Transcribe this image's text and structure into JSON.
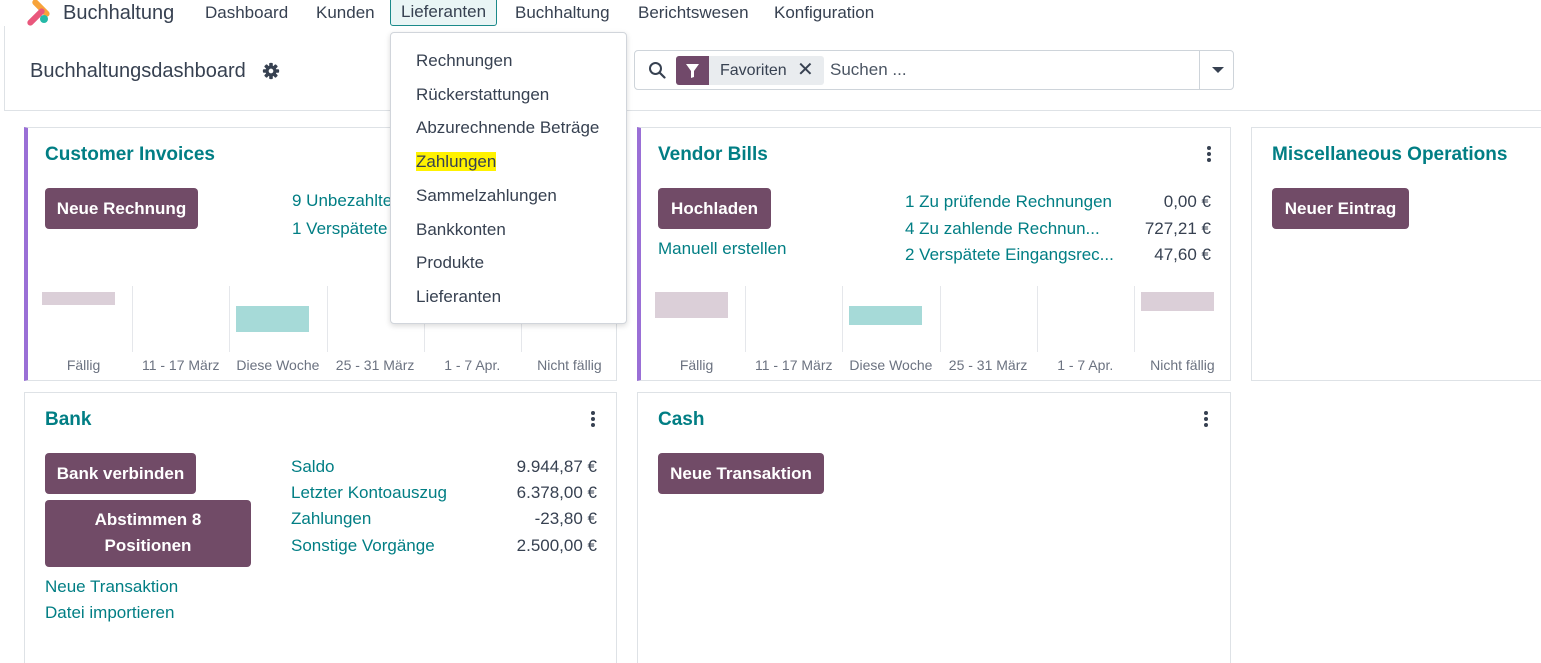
{
  "app": {
    "name": "Buchhaltung",
    "menu": [
      "Dashboard",
      "Kunden",
      "Lieferanten",
      "Buchhaltung",
      "Berichtswesen",
      "Konfiguration"
    ],
    "active_menu": "Lieferanten"
  },
  "control_panel": {
    "breadcrumb": "Buchhaltungsdashboard",
    "search": {
      "facet_label": "Favoriten",
      "placeholder": "Suchen ..."
    }
  },
  "dropdown": {
    "items": [
      "Rechnungen",
      "Rückerstattungen",
      "Abzurechnende Beträge",
      "Zahlungen",
      "Sammelzahlungen",
      "Bankkonten",
      "Produkte",
      "Lieferanten"
    ],
    "highlighted": "Zahlungen"
  },
  "cards": {
    "customer_invoices": {
      "title": "Customer Invoices",
      "button": "Neue Rechnung",
      "links": [
        "9 Unbezahlte",
        "1 Verspätete"
      ]
    },
    "vendor_bills": {
      "title": "Vendor Bills",
      "button": "Hochladen",
      "secondary_link": "Manuell erstellen",
      "rows": [
        {
          "label": "1 Zu prüfende Rechnungen",
          "amount": "0,00 €"
        },
        {
          "label": "4 Zu zahlende Rechnun...",
          "amount": "727,21 €"
        },
        {
          "label": "2 Verspätete Eingangsrec...",
          "amount": "47,60 €"
        }
      ]
    },
    "misc": {
      "title": "Miscellaneous Operations",
      "button": "Neuer Eintrag"
    },
    "bank": {
      "title": "Bank",
      "button_connect": "Bank verbinden",
      "button_reconcile": "Abstimmen 8 Positionen",
      "links": [
        "Neue Transaktion",
        "Datei importieren"
      ],
      "rows": [
        {
          "label": "Saldo",
          "amount": "9.944,87 €"
        },
        {
          "label": "Letzter Kontoauszug",
          "amount": "6.378,00 €"
        },
        {
          "label": "Zahlungen",
          "amount": "-23,80 €"
        },
        {
          "label": "Sonstige Vorgänge",
          "amount": "2.500,00 €"
        }
      ]
    },
    "cash": {
      "title": "Cash",
      "button": "Neue Transaktion"
    }
  },
  "chart_data": [
    {
      "type": "bar",
      "categories": [
        "Fällig",
        "11 - 17 März",
        "Diese Woche",
        "25 - 31 März",
        "1 - 7 Apr.",
        "Nicht fällig"
      ],
      "values": [
        15,
        0,
        30,
        0,
        0,
        0
      ],
      "current_index": 2,
      "colors": {
        "past": "#dbcfd8",
        "current": "#a6dad8"
      }
    },
    {
      "type": "bar",
      "categories": [
        "Fällig",
        "11 - 17 März",
        "Diese Woche",
        "25 - 31 März",
        "1 - 7 Apr.",
        "Nicht fällig"
      ],
      "values": [
        47.6,
        0,
        34,
        0,
        0,
        34
      ],
      "current_index": 2,
      "colors": {
        "past": "#dbcfd8",
        "current": "#a6dad8"
      }
    }
  ],
  "colors": {
    "primary": "#714b67",
    "link": "#017e84",
    "accent_border": "#9a6fd6",
    "highlight": "#fff200"
  },
  "icons": [
    "app-logo-icon",
    "gear-icon",
    "search-icon",
    "filter-icon",
    "close-icon",
    "caret-down-icon",
    "kebab-menu-icon"
  ]
}
